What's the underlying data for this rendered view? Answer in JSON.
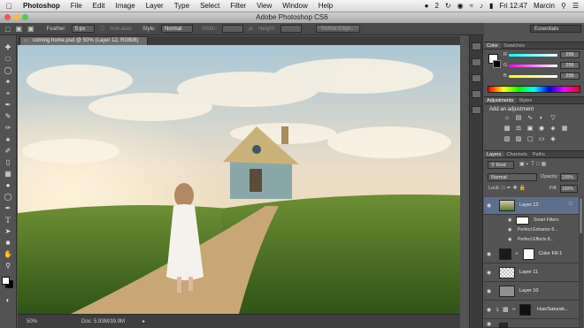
{
  "menubar": {
    "items": [
      "Photoshop",
      "File",
      "Edit",
      "Image",
      "Layer",
      "Type",
      "Select",
      "Filter",
      "View",
      "Window",
      "Help"
    ],
    "badge": "2",
    "clock": "Fri 12:47",
    "user": "Marcin"
  },
  "window": {
    "title": "Adobe Photoshop CS6"
  },
  "options": {
    "feather_label": "Feather:",
    "feather_value": "5 px",
    "antialias_label": "Anti-alias",
    "style_label": "Style:",
    "style_value": "Normal",
    "width_label": "Width:",
    "height_label": "Height:",
    "refine_edge": "Refine Edge...",
    "workspace": "Essentials"
  },
  "document": {
    "tab_label": "coming home.psd @ 50% (Layer 12, RGB/8)",
    "zoom": "50%",
    "doc_size": "Doc: 5.93M/39.9M"
  },
  "color_panel": {
    "tabs": [
      "Color",
      "Swatches"
    ],
    "channels": [
      {
        "label": "R",
        "value": "255"
      },
      {
        "label": "G",
        "value": "255"
      },
      {
        "label": "B",
        "value": "255"
      }
    ]
  },
  "adjustments_panel": {
    "tabs": [
      "Adjustments",
      "Styles"
    ],
    "heading": "Add an adjustment"
  },
  "layers_panel": {
    "tabs": [
      "Layers",
      "Channels",
      "Paths"
    ],
    "filter": "Kind",
    "blend_mode": "Normal",
    "opacity_label": "Opacity:",
    "opacity_value": "100%",
    "lock_label": "Lock:",
    "fill_label": "Fill:",
    "fill_value": "100%",
    "layers": [
      {
        "name": "Layer 12"
      },
      {
        "name": "Smart Filters"
      },
      {
        "name": "Perfect Enhance 8..."
      },
      {
        "name": "Perfect Effects 8..."
      },
      {
        "name": "Color Fill 1"
      },
      {
        "name": "Layer 11"
      },
      {
        "name": "Layer 10"
      },
      {
        "name": "Hue/Saturati..."
      }
    ]
  },
  "colors": {
    "ps_bg": "#535353",
    "layer_selected": "#5d6f8a",
    "grass": "#4d7a2a",
    "sky": "#b9d3e0"
  }
}
